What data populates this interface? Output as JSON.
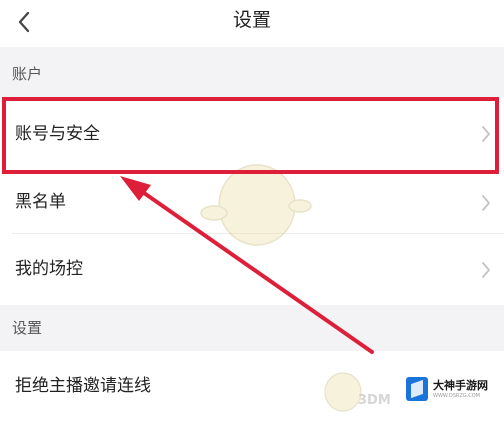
{
  "header": {
    "title": "设置"
  },
  "sections": {
    "account": "账户",
    "settings": "设置"
  },
  "rows": [
    {
      "label": "账号与安全",
      "has_chevron": true,
      "highlighted": true
    },
    {
      "label": "黑名单",
      "has_chevron": true
    },
    {
      "label": "我的场控",
      "has_chevron": true
    },
    {
      "label": "拒绝主播邀请连线",
      "has_chevron": false
    }
  ],
  "annotation": {
    "color": "#dd1f3a",
    "type": "highlight-box-with-arrow"
  },
  "watermark": {
    "title": "大神手游网",
    "subtitle": "WWW.DSRZG.COM",
    "site_mark": "3DM"
  },
  "icons": {
    "back": "chevron-left-icon",
    "row_arrow": "chevron-right-icon",
    "watermark_logo": "cube-logo-icon"
  },
  "colors": {
    "section_bg": "#f3f3f5",
    "annotation": "#dd1f3a",
    "watermark_logo": "#1a73d9"
  }
}
